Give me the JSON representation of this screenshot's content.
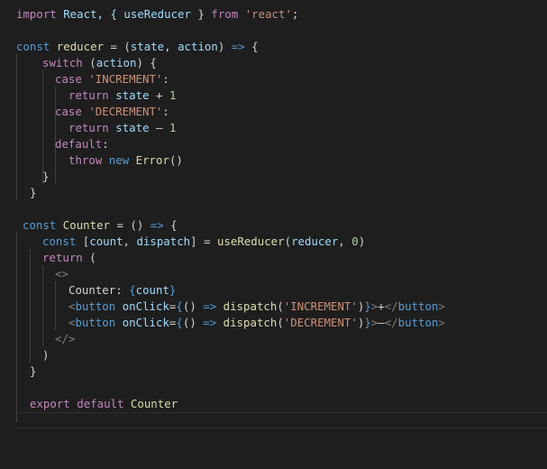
{
  "editor": {
    "lines": [
      {
        "indent": 18,
        "tokens": [
          {
            "t": "import",
            "c": "kw"
          },
          {
            "t": " React, { ",
            "c": "var"
          },
          {
            "t": "useReducer",
            "c": "var"
          },
          {
            "t": " } ",
            "c": "plain"
          },
          {
            "t": "from",
            "c": "kw"
          },
          {
            "t": " ",
            "c": "plain"
          },
          {
            "t": "'react'",
            "c": "str"
          },
          {
            "t": ";",
            "c": "plain"
          }
        ]
      },
      {
        "indent": 18,
        "tokens": []
      },
      {
        "indent": 18,
        "tokens": [
          {
            "t": "const",
            "c": "kw2"
          },
          {
            "t": " ",
            "c": "plain"
          },
          {
            "t": "reducer",
            "c": "fn"
          },
          {
            "t": " = (",
            "c": "plain"
          },
          {
            "t": "state",
            "c": "var"
          },
          {
            "t": ", ",
            "c": "plain"
          },
          {
            "t": "action",
            "c": "var"
          },
          {
            "t": ") ",
            "c": "plain"
          },
          {
            "t": "=>",
            "c": "kw2"
          },
          {
            "t": " {",
            "c": "plain"
          }
        ]
      },
      {
        "indent": 47,
        "tokens": [
          {
            "t": "switch",
            "c": "kw"
          },
          {
            "t": " (",
            "c": "plain"
          },
          {
            "t": "action",
            "c": "var"
          },
          {
            "t": ") {",
            "c": "plain"
          }
        ]
      },
      {
        "indent": 61,
        "tokens": [
          {
            "t": "case",
            "c": "kw"
          },
          {
            "t": " ",
            "c": "plain"
          },
          {
            "t": "'INCREMENT'",
            "c": "str"
          },
          {
            "t": ":",
            "c": "plain"
          }
        ]
      },
      {
        "indent": 76,
        "tokens": [
          {
            "t": "return",
            "c": "kw"
          },
          {
            "t": " ",
            "c": "plain"
          },
          {
            "t": "state",
            "c": "var"
          },
          {
            "t": " + ",
            "c": "plain"
          },
          {
            "t": "1",
            "c": "num"
          }
        ]
      },
      {
        "indent": 61,
        "tokens": [
          {
            "t": "case",
            "c": "kw"
          },
          {
            "t": " ",
            "c": "plain"
          },
          {
            "t": "'DECREMENT'",
            "c": "str"
          },
          {
            "t": ":",
            "c": "plain"
          }
        ]
      },
      {
        "indent": 76,
        "tokens": [
          {
            "t": "return",
            "c": "kw"
          },
          {
            "t": " ",
            "c": "plain"
          },
          {
            "t": "state",
            "c": "var"
          },
          {
            "t": " – ",
            "c": "plain"
          },
          {
            "t": "1",
            "c": "num"
          }
        ]
      },
      {
        "indent": 61,
        "tokens": [
          {
            "t": "default",
            "c": "kw"
          },
          {
            "t": ":",
            "c": "plain"
          }
        ]
      },
      {
        "indent": 76,
        "tokens": [
          {
            "t": "throw",
            "c": "kw"
          },
          {
            "t": " ",
            "c": "plain"
          },
          {
            "t": "new",
            "c": "kw2"
          },
          {
            "t": " ",
            "c": "plain"
          },
          {
            "t": "Error",
            "c": "fn"
          },
          {
            "t": "()",
            "c": "plain"
          }
        ]
      },
      {
        "indent": 47,
        "tokens": [
          {
            "t": "}",
            "c": "plain"
          }
        ]
      },
      {
        "indent": 33,
        "tokens": [
          {
            "t": "}",
            "c": "plain"
          }
        ]
      },
      {
        "indent": 18,
        "tokens": []
      },
      {
        "indent": 25,
        "tokens": [
          {
            "t": "const",
            "c": "kw2"
          },
          {
            "t": " ",
            "c": "plain"
          },
          {
            "t": "Counter",
            "c": "fn"
          },
          {
            "t": " = () ",
            "c": "plain"
          },
          {
            "t": "=>",
            "c": "kw2"
          },
          {
            "t": " {",
            "c": "plain"
          }
        ]
      },
      {
        "indent": 47,
        "tokens": [
          {
            "t": "const",
            "c": "kw2"
          },
          {
            "t": " [",
            "c": "plain"
          },
          {
            "t": "count",
            "c": "var"
          },
          {
            "t": ", ",
            "c": "plain"
          },
          {
            "t": "dispatch",
            "c": "var"
          },
          {
            "t": "] = ",
            "c": "plain"
          },
          {
            "t": "useReducer",
            "c": "fn"
          },
          {
            "t": "(",
            "c": "plain"
          },
          {
            "t": "reducer",
            "c": "var"
          },
          {
            "t": ", ",
            "c": "plain"
          },
          {
            "t": "0",
            "c": "num"
          },
          {
            "t": ")",
            "c": "plain"
          }
        ]
      },
      {
        "indent": 47,
        "tokens": [
          {
            "t": "return",
            "c": "kw"
          },
          {
            "t": " (",
            "c": "plain"
          }
        ]
      },
      {
        "indent": 61,
        "tokens": [
          {
            "t": "<>",
            "c": "tag"
          }
        ]
      },
      {
        "indent": 76,
        "tokens": [
          {
            "t": "Counter: ",
            "c": "plain"
          },
          {
            "t": "{",
            "c": "brace"
          },
          {
            "t": "count",
            "c": "var"
          },
          {
            "t": "}",
            "c": "brace"
          }
        ]
      },
      {
        "indent": 76,
        "tokens": [
          {
            "t": "<",
            "c": "tag"
          },
          {
            "t": "button",
            "c": "tagn"
          },
          {
            "t": " ",
            "c": "plain"
          },
          {
            "t": "onClick",
            "c": "attr"
          },
          {
            "t": "=",
            "c": "plain"
          },
          {
            "t": "{",
            "c": "brace"
          },
          {
            "t": "() ",
            "c": "plain"
          },
          {
            "t": "=>",
            "c": "kw2"
          },
          {
            "t": " ",
            "c": "plain"
          },
          {
            "t": "dispatch",
            "c": "fn"
          },
          {
            "t": "(",
            "c": "plain"
          },
          {
            "t": "'INCREMENT'",
            "c": "str"
          },
          {
            "t": ")",
            "c": "plain"
          },
          {
            "t": "}",
            "c": "brace"
          },
          {
            "t": ">",
            "c": "tag"
          },
          {
            "t": "+",
            "c": "plain"
          },
          {
            "t": "</",
            "c": "tag"
          },
          {
            "t": "button",
            "c": "tagn"
          },
          {
            "t": ">",
            "c": "tag"
          }
        ]
      },
      {
        "indent": 76,
        "tokens": [
          {
            "t": "<",
            "c": "tag"
          },
          {
            "t": "button",
            "c": "tagn"
          },
          {
            "t": " ",
            "c": "plain"
          },
          {
            "t": "onClick",
            "c": "attr"
          },
          {
            "t": "=",
            "c": "plain"
          },
          {
            "t": "{",
            "c": "brace"
          },
          {
            "t": "() ",
            "c": "plain"
          },
          {
            "t": "=>",
            "c": "kw2"
          },
          {
            "t": " ",
            "c": "plain"
          },
          {
            "t": "dispatch",
            "c": "fn"
          },
          {
            "t": "(",
            "c": "plain"
          },
          {
            "t": "'DECREMENT'",
            "c": "str"
          },
          {
            "t": ")",
            "c": "plain"
          },
          {
            "t": "}",
            "c": "brace"
          },
          {
            "t": ">",
            "c": "tag"
          },
          {
            "t": "–",
            "c": "plain"
          },
          {
            "t": "</",
            "c": "tag"
          },
          {
            "t": "button",
            "c": "tagn"
          },
          {
            "t": ">",
            "c": "tag"
          }
        ]
      },
      {
        "indent": 61,
        "tokens": [
          {
            "t": "</>",
            "c": "tag"
          }
        ]
      },
      {
        "indent": 47,
        "tokens": [
          {
            "t": ")",
            "c": "plain"
          }
        ]
      },
      {
        "indent": 33,
        "tokens": [
          {
            "t": "}",
            "c": "plain"
          }
        ]
      },
      {
        "indent": 18,
        "tokens": []
      },
      {
        "indent": 33,
        "tokens": [
          {
            "t": "export",
            "c": "kw"
          },
          {
            "t": " ",
            "c": "plain"
          },
          {
            "t": "default",
            "c": "kw"
          },
          {
            "t": " ",
            "c": "plain"
          },
          {
            "t": "Counter",
            "c": "fn"
          }
        ]
      }
    ]
  },
  "theme": {
    "background": "#1e1e1e",
    "keyword": "#c586c0",
    "storage": "#569cd6",
    "function": "#dcdcaa",
    "variable": "#9cdcfe",
    "string": "#ce9178",
    "number": "#b5cea8",
    "text": "#d4d4d4"
  }
}
